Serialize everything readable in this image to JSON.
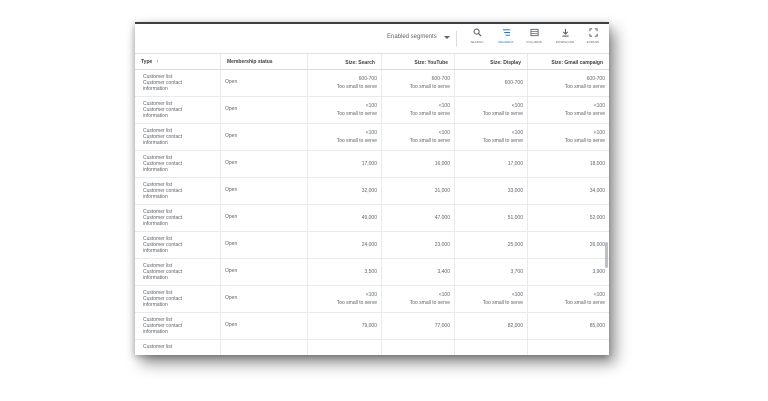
{
  "toolbar": {
    "segments_label": "Enabled segments",
    "buttons": [
      {
        "label": "Search",
        "icon": "search-icon"
      },
      {
        "label": "Segment",
        "icon": "segment-icon"
      },
      {
        "label": "Columns",
        "icon": "columns-icon"
      },
      {
        "label": "Download",
        "icon": "download-icon"
      },
      {
        "label": "Expand",
        "icon": "expand-icon"
      }
    ],
    "active_color": "#1a73e8"
  },
  "table": {
    "columns": [
      "Type",
      "Membership status",
      "Size: Search",
      "Size: YouTube",
      "Size: Display",
      "Size: Gmail campaign"
    ],
    "sort_indicator": "↑",
    "rows": [
      {
        "type": [
          "Customer list",
          "Customer contact",
          "information"
        ],
        "status": "Open",
        "search": [
          "600-700",
          "Too small to serve"
        ],
        "youtube": [
          "600-700",
          "Too small to serve"
        ],
        "display": [
          "600-700"
        ],
        "gmail": [
          "600-700",
          "Too small to serve"
        ]
      },
      {
        "type": [
          "Customer list",
          "Customer contact",
          "information"
        ],
        "status": "Open",
        "search": [
          "<100",
          "Too small to serve"
        ],
        "youtube": [
          "<100",
          "Too small to serve"
        ],
        "display": [
          "<100",
          "Too small to serve"
        ],
        "gmail": [
          "<100",
          "Too small to serve"
        ]
      },
      {
        "type": [
          "Customer list",
          "Customer contact",
          "information"
        ],
        "status": "Open",
        "search": [
          "<100",
          "Too small to serve"
        ],
        "youtube": [
          "<100",
          "Too small to serve"
        ],
        "display": [
          "<100",
          "Too small to serve"
        ],
        "gmail": [
          "<100",
          "Too small to serve"
        ]
      },
      {
        "type": [
          "Customer list",
          "Customer contact",
          "information"
        ],
        "status": "Open",
        "search": [
          "17,000"
        ],
        "youtube": [
          "16,000"
        ],
        "display": [
          "17,000"
        ],
        "gmail": [
          "18,000"
        ]
      },
      {
        "type": [
          "Customer list",
          "Customer contact",
          "information"
        ],
        "status": "Open",
        "search": [
          "32,000"
        ],
        "youtube": [
          "31,000"
        ],
        "display": [
          "33,000"
        ],
        "gmail": [
          "34,000"
        ]
      },
      {
        "type": [
          "Customer list",
          "Customer contact",
          "information"
        ],
        "status": "Open",
        "search": [
          "49,000"
        ],
        "youtube": [
          "47,000"
        ],
        "display": [
          "51,000"
        ],
        "gmail": [
          "52,000"
        ]
      },
      {
        "type": [
          "Customer list",
          "Customer contact",
          "information"
        ],
        "status": "Open",
        "search": [
          "24,000"
        ],
        "youtube": [
          "23,000"
        ],
        "display": [
          "25,000"
        ],
        "gmail": [
          "26,000"
        ]
      },
      {
        "type": [
          "Customer list",
          "Customer contact",
          "information"
        ],
        "status": "Open",
        "search": [
          "3,500"
        ],
        "youtube": [
          "3,400"
        ],
        "display": [
          "3,700"
        ],
        "gmail": [
          "3,900"
        ]
      },
      {
        "type": [
          "Customer list",
          "Customer contact",
          "information"
        ],
        "status": "Open",
        "search": [
          "<100",
          "Too small to serve"
        ],
        "youtube": [
          "<100",
          "Too small to serve"
        ],
        "display": [
          "<100",
          "Too small to serve"
        ],
        "gmail": [
          "<100",
          "Too small to serve"
        ]
      },
      {
        "type": [
          "Customer list",
          "Customer contact",
          "information"
        ],
        "status": "Open",
        "search": [
          "79,000"
        ],
        "youtube": [
          "77,000"
        ],
        "display": [
          "82,000"
        ],
        "gmail": [
          "85,000"
        ]
      },
      {
        "type": [
          "Customer list"
        ],
        "status": "",
        "search": [],
        "youtube": [],
        "display": [],
        "gmail": []
      }
    ]
  }
}
